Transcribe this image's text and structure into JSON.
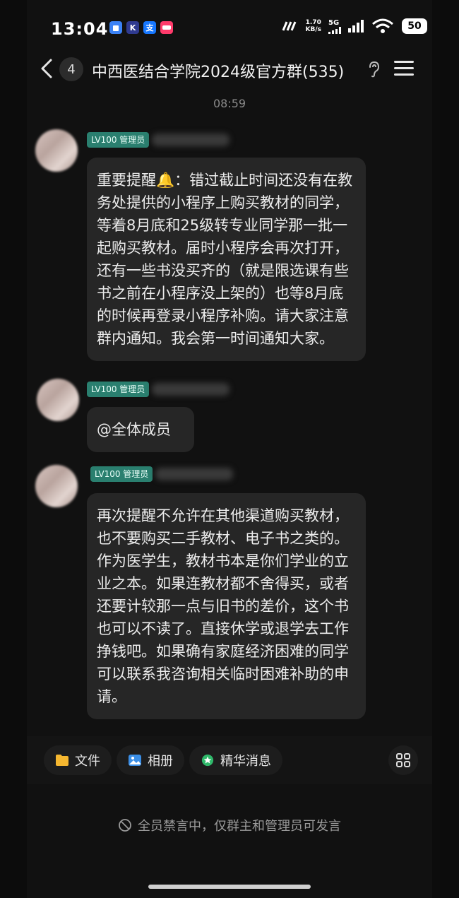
{
  "status_bar": {
    "time": "13:04",
    "app_icons": [
      {
        "name": "app-icon-blue",
        "glyph": "",
        "color": "#3b82f6"
      },
      {
        "name": "app-icon-k",
        "glyph": "K",
        "color": "#2f3a8f"
      },
      {
        "name": "app-icon-alipay",
        "glyph": "支",
        "color": "#1677ff"
      },
      {
        "name": "app-icon-pink",
        "glyph": "",
        "color": "#ff3b6b"
      }
    ],
    "net_speed_value": "1.70",
    "net_speed_unit": "KB/s",
    "network_type": "5G",
    "battery": "50"
  },
  "header": {
    "back_badge": "4",
    "title": "中西医结合学院2024级官方群(535)"
  },
  "timestamp": "08:59",
  "messages": [
    {
      "badge": "LV100 管理员",
      "text": "重要提醒🔔：错过截止时间还没有在教务处提供的小程序上购买教材的同学，等着8月底和25级转专业同学那一批一起购买教材。届时小程序会再次打开，还有一些书没买齐的（就是限选课有些书之前在小程序没上架的）也等8月底的时候再登录小程序补购。请大家注意群内通知。我会第一时间通知大家。"
    },
    {
      "badge": "LV100 管理员",
      "text": "@全体成员"
    },
    {
      "badge": "LV100 管理员",
      "text": "再次提醒不允许在其他渠道购买教材，也不要购买二手教材、电子书之类的。作为医学生，教材书本是你们学业的立业之本。如果连教材都不舍得买，或者还要计较那一点与旧书的差价，这个书也可以不读了。直接休学或退学去工作挣钱吧。如果确有家庭经济困难的同学可以联系我咨询相关临时困难补助的申请。"
    }
  ],
  "toolbar": {
    "files_label": "文件",
    "album_label": "相册",
    "essence_label": "精华消息"
  },
  "mute_notice": "全员禁言中，仅群主和管理员可发言",
  "colors": {
    "admin_badge": "#2a7f6f",
    "bubble": "#262626",
    "background": "#111111"
  }
}
